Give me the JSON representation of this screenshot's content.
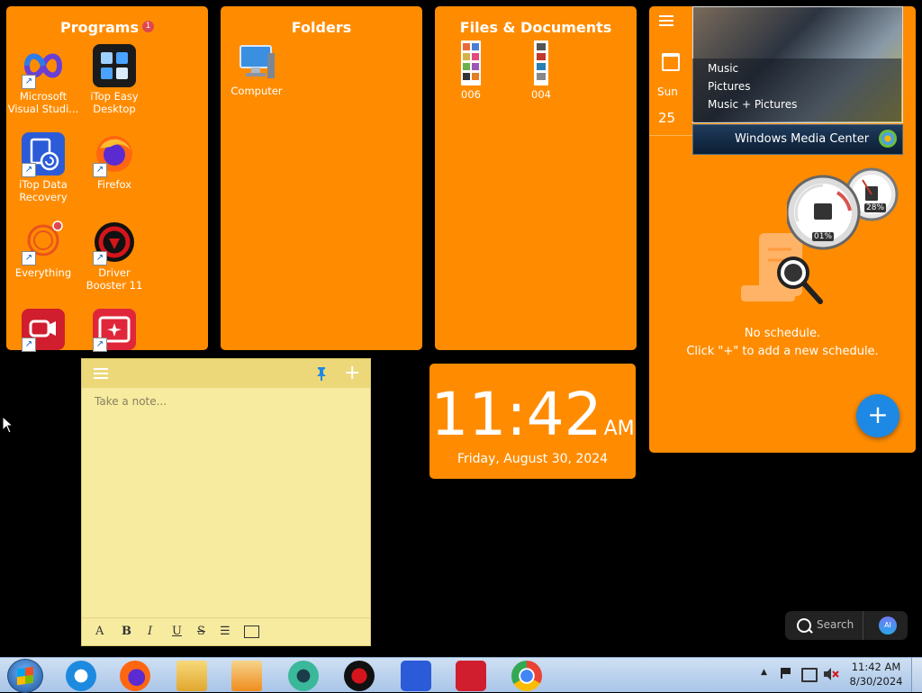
{
  "programs": {
    "title": "Programs",
    "badge": "1",
    "icons": [
      {
        "label": "Microsoft Visual Studi...",
        "icon": "visual-studio-icon"
      },
      {
        "label": "iTop Easy Desktop",
        "icon": "itop-easy-desktop-icon"
      },
      {
        "label": "iTop Data Recovery",
        "icon": "itop-data-recovery-icon"
      },
      {
        "label": "Firefox",
        "icon": "firefox-icon"
      },
      {
        "label": "Everything",
        "icon": "everything-icon"
      },
      {
        "label": "Driver Booster 11",
        "icon": "driver-booster-icon"
      }
    ]
  },
  "folders": {
    "title": "Folders",
    "items": [
      {
        "label": "Computer",
        "icon": "computer-icon"
      }
    ]
  },
  "files": {
    "title": "Files & Documents",
    "items": [
      {
        "label": "006"
      },
      {
        "label": "004"
      }
    ]
  },
  "calendar": {
    "day_name": "Sun",
    "day_number": "25",
    "empty_line1": "No schedule.",
    "empty_line2": "Click \"+\" to add a new schedule."
  },
  "media_center": {
    "menu": [
      "Music",
      "Pictures",
      "Music + Pictures"
    ],
    "brand_windows": "Windows",
    "brand_rest": "Media Center"
  },
  "gauges": {
    "cpu": "01%",
    "memory": "28%"
  },
  "note": {
    "placeholder": "Take a note..."
  },
  "clock": {
    "time": "11:42",
    "ampm": "AM",
    "date": "Friday, August 30, 2024"
  },
  "search": {
    "label": "Search",
    "ai": "AI"
  },
  "taskbar": {
    "time": "11:42 AM",
    "date": "8/30/2024"
  },
  "colors": {
    "panel": "#ff8c00",
    "note": "#f7eb9f",
    "fab": "#1e88e5"
  }
}
